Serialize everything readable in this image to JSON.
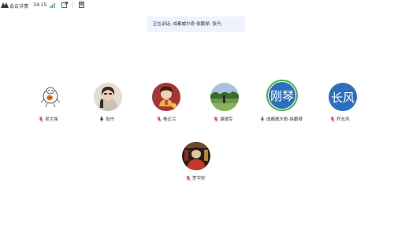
{
  "toolbar": {
    "meeting_label": "会议详情",
    "timer": "34:15"
  },
  "speaking_banner": "正在讲话: 成都威尔奇-徐鹏琴; 张丹;",
  "participants": [
    {
      "name": "吴文强",
      "mic": "muted"
    },
    {
      "name": "张丹",
      "mic": "speaking"
    },
    {
      "name": "杨正兰",
      "mic": "muted"
    },
    {
      "name": "谭德军",
      "mic": "muted"
    },
    {
      "name": "成都威尔奇-徐鹏琴",
      "mic": "speaking",
      "avatar_text": "刚琴",
      "avatar_color": "#2e6fbd"
    },
    {
      "name": "乔长风",
      "mic": "muted",
      "avatar_text": "长风",
      "avatar_color": "#2e6fbd"
    },
    {
      "name": "罗宇轩",
      "mic": "muted"
    }
  ],
  "colors": {
    "muted_mic": "#e04b4b",
    "speaking_mic": "#2c8a3b",
    "speaking_ring": "#3ab549"
  }
}
